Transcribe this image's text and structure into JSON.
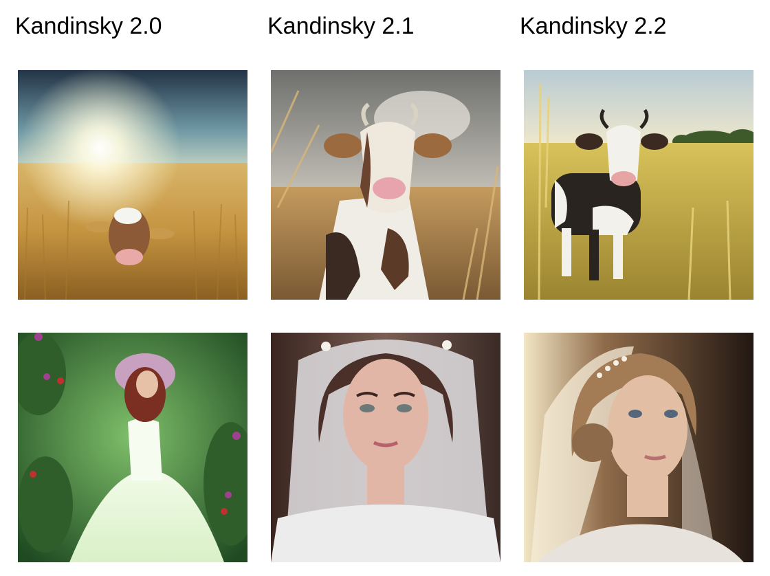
{
  "columns": [
    {
      "title": "Kandinsky 2.0"
    },
    {
      "title": "Kandinsky 2.1"
    },
    {
      "title": "Kandinsky 2.2"
    }
  ],
  "images": [
    {
      "subject": "cow in wheat field with sun",
      "model": "Kandinsky 2.0"
    },
    {
      "subject": "cow in wheat field",
      "model": "Kandinsky 2.1"
    },
    {
      "subject": "cow in wheat field",
      "model": "Kandinsky 2.2"
    },
    {
      "subject": "bride with flower crown in garden",
      "model": "Kandinsky 2.0"
    },
    {
      "subject": "bride portrait with veil",
      "model": "Kandinsky 2.1"
    },
    {
      "subject": "bride portrait in window light",
      "model": "Kandinsky 2.2"
    }
  ]
}
